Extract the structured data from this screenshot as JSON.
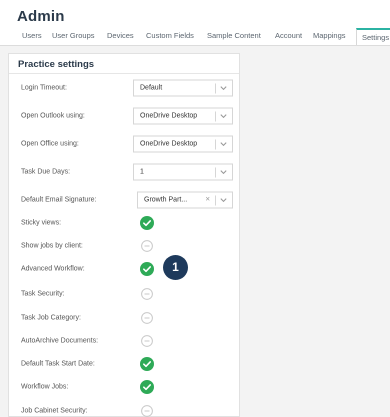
{
  "page": {
    "title": "Admin"
  },
  "tabs": [
    {
      "label": "Users",
      "active": false
    },
    {
      "label": "User Groups",
      "active": false
    },
    {
      "label": "Devices",
      "active": false
    },
    {
      "label": "Custom Fields",
      "active": false
    },
    {
      "label": "Sample Content",
      "active": false
    },
    {
      "label": "Account",
      "active": false
    },
    {
      "label": "Mappings",
      "active": false
    },
    {
      "label": "Settings",
      "active": true
    }
  ],
  "panel": {
    "title": "Practice settings",
    "dropdowns": [
      {
        "label": "Login Timeout:",
        "value": "Default",
        "clearable": false
      },
      {
        "label": "Open Outlook using:",
        "value": "OneDrive Desktop",
        "clearable": false
      },
      {
        "label": "Open Office using:",
        "value": "OneDrive Desktop",
        "clearable": false
      },
      {
        "label": "Task Due Days:",
        "value": "1",
        "clearable": false
      },
      {
        "label": "Default Email Signature:",
        "value": "Growth Part...",
        "clearable": true,
        "clear_glyph": "×"
      }
    ],
    "toggles": [
      {
        "label": "Sticky views:",
        "enabled": true
      },
      {
        "label": "Show jobs by client:",
        "enabled": false
      },
      {
        "label": "Advanced Workflow:",
        "enabled": true
      },
      {
        "label": "Task Security:",
        "enabled": false
      },
      {
        "label": "Task Job Category:",
        "enabled": false
      },
      {
        "label": "AutoArchive Documents:",
        "enabled": false
      },
      {
        "label": "Default Task Start Date:",
        "enabled": true
      },
      {
        "label": "Workflow Jobs:",
        "enabled": true
      },
      {
        "label": "Job Cabinet Security:",
        "enabled": false
      }
    ]
  },
  "step_badge": "1",
  "colors": {
    "accent": "#2bb3a3",
    "check_green": "#2eaa57",
    "badge": "#1e3a5c"
  }
}
